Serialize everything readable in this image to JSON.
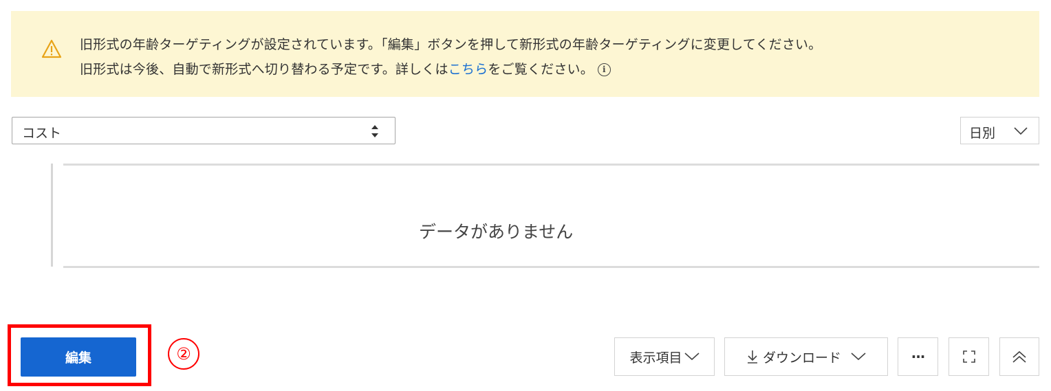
{
  "notice": {
    "icon": "warning-icon",
    "line1": "旧形式の年齢ターゲティングが設定されています。「編集」ボタンを押して新形式の年齢ターゲティングに変更してください。",
    "line2_prefix": "旧形式は今後、自動で新形式へ切り替わる予定です。詳しくは",
    "line2_link": "こちら",
    "line2_suffix": "をご覧ください。",
    "info_icon": "ⓘ"
  },
  "metric_select": {
    "value": "コスト",
    "icon": "sort-arrows-icon"
  },
  "period_select": {
    "value": "日別",
    "icon": "chevron-down-icon"
  },
  "chart": {
    "empty_message": "データがありません"
  },
  "actions": {
    "edit_label": "編集",
    "step_marker": "②"
  },
  "toolbar": {
    "columns_label": "表示項目",
    "download_label": "ダウンロード",
    "more_icon": "more-icon",
    "more_label": "···",
    "expand_icon": "fullscreen-icon",
    "collapse_icon": "double-chevron-up-icon"
  },
  "colors": {
    "notice_bg": "#fdf6d3",
    "warning": "#e8a317",
    "link": "#1a6fd1",
    "primary_button": "#1566d1",
    "highlight": "#ff0000"
  }
}
